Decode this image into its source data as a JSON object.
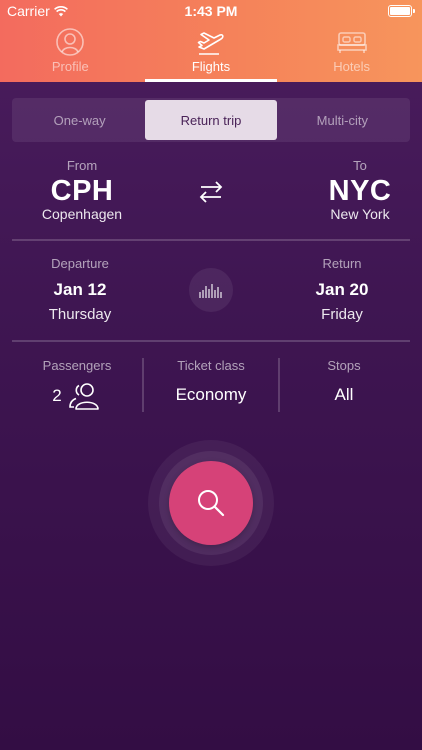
{
  "status_bar": {
    "carrier": "Carrier",
    "time": "1:43 PM"
  },
  "tabs": [
    {
      "label": "Profile",
      "icon": "profile-icon",
      "active": false
    },
    {
      "label": "Flights",
      "icon": "plane-icon",
      "active": true
    },
    {
      "label": "Hotels",
      "icon": "bed-icon",
      "active": false
    }
  ],
  "trip_type": {
    "options": [
      "One-way",
      "Return trip",
      "Multi-city"
    ],
    "selected": "Return trip"
  },
  "route": {
    "from_label": "From",
    "from_code": "CPH",
    "from_city": "Copenhagen",
    "to_label": "To",
    "to_code": "NYC",
    "to_city": "New York"
  },
  "dates": {
    "departure_label": "Departure",
    "departure_date": "Jan 12",
    "departure_weekday": "Thursday",
    "return_label": "Return",
    "return_date": "Jan 20",
    "return_weekday": "Friday"
  },
  "details": {
    "passengers_label": "Passengers",
    "passengers_count": "2",
    "ticket_class_label": "Ticket class",
    "ticket_class": "Economy",
    "stops_label": "Stops",
    "stops": "All"
  },
  "colors": {
    "header_start": "#f36b5e",
    "header_end": "#f7955c",
    "background": "#3f1652",
    "search_button": "#d64278",
    "segment_active": "#e6dbe7"
  }
}
